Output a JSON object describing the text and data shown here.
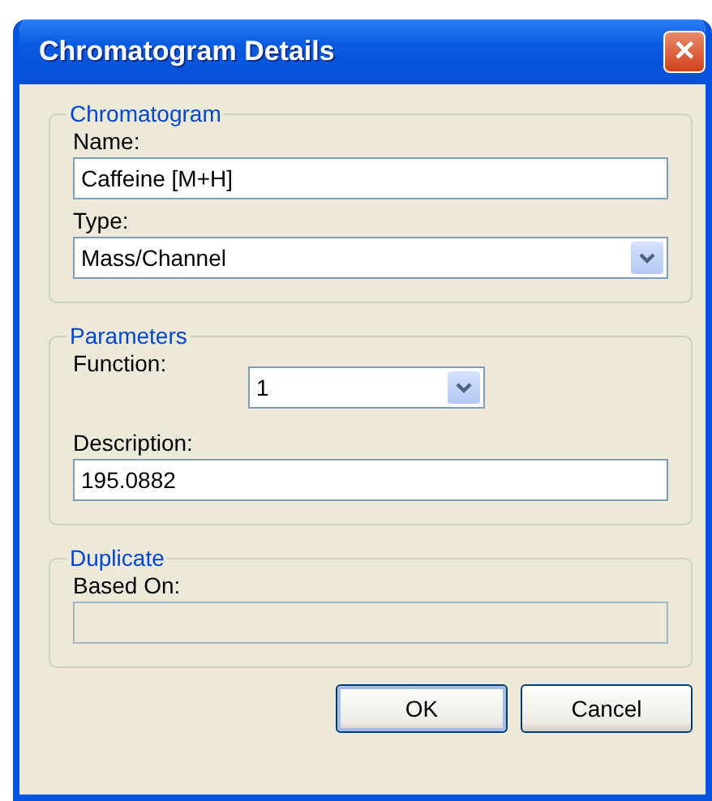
{
  "window": {
    "title": "Chromatogram Details",
    "close": "✕"
  },
  "groups": [
    {
      "title": "Chromatogram",
      "fields": [
        {
          "kind": "text",
          "label": "Name:",
          "value": "Caffeine [M+H]",
          "disabled": false
        },
        {
          "kind": "select",
          "label": "Type:",
          "value": "Mass/Channel",
          "disabled": false
        }
      ]
    },
    {
      "title": "Parameters",
      "fields": [
        {
          "kind": "inline-select",
          "label": "Function:",
          "value": "1",
          "disabled": false
        },
        {
          "kind": "text",
          "label": "Description:",
          "value": "195.0882",
          "disabled": false
        }
      ]
    },
    {
      "title": "Duplicate",
      "fields": [
        {
          "kind": "text",
          "label": "Based On:",
          "disabled": true
        }
      ]
    }
  ],
  "buttons": [
    {
      "label": "OK",
      "default": true
    },
    {
      "label": "Cancel",
      "default": false
    }
  ]
}
